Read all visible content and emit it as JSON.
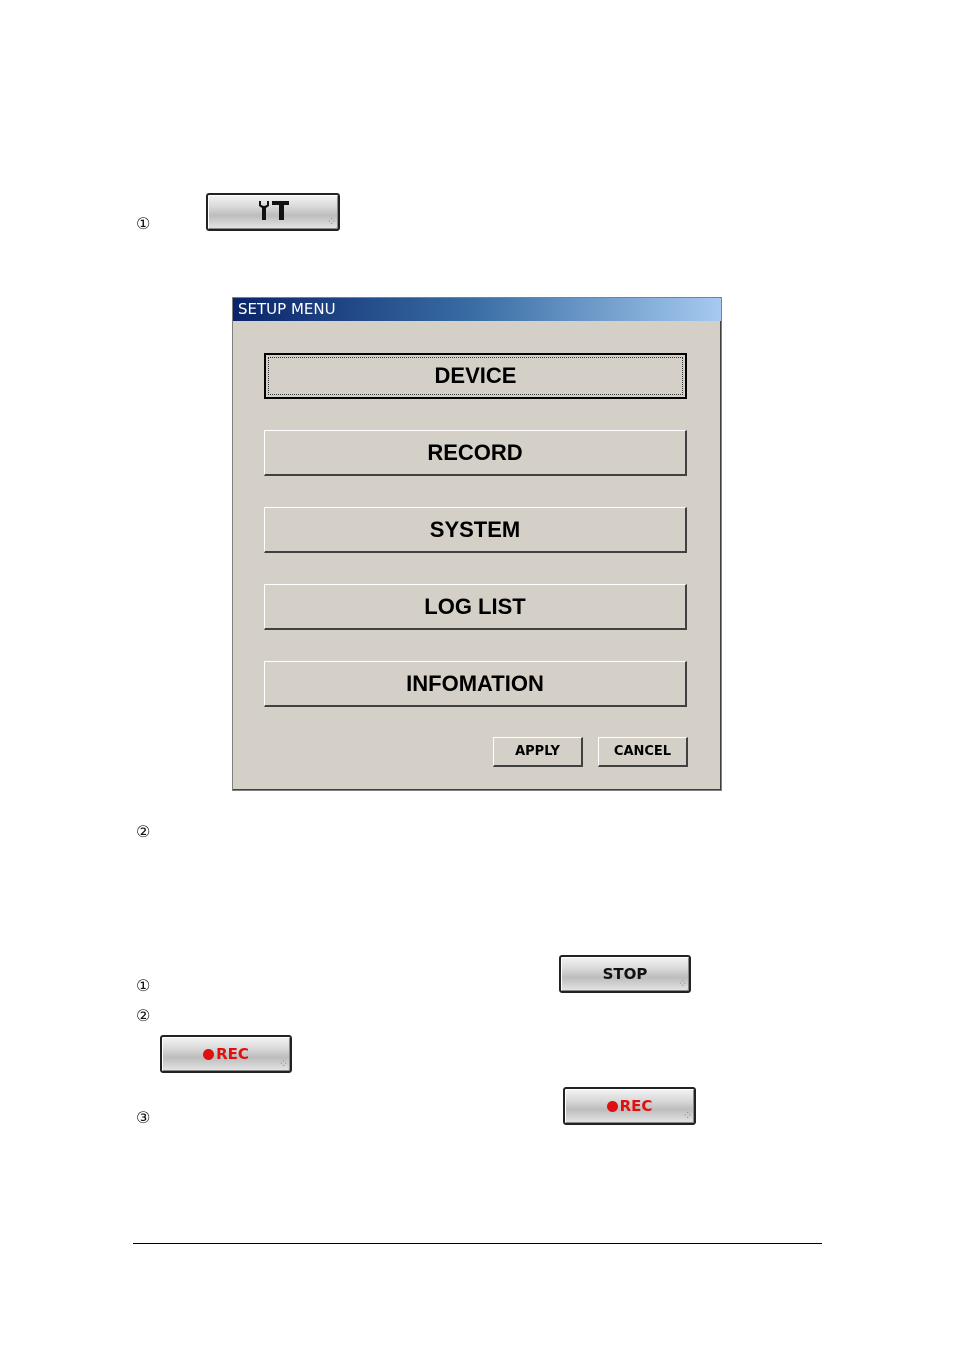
{
  "markers": {
    "step1a": "①",
    "step2a": "②",
    "step1b": "①",
    "step2b": "②",
    "step3b": "③"
  },
  "buttons": {
    "setup_icon": "tools-icon",
    "stop_label": "STOP",
    "rec_label": "REC",
    "rec_label_2": "REC"
  },
  "dialog": {
    "title": "SETUP MENU",
    "menu_items": [
      {
        "label": "DEVICE",
        "focused": true
      },
      {
        "label": "RECORD"
      },
      {
        "label": "SYSTEM"
      },
      {
        "label": "LOG LIST"
      },
      {
        "label": "INFOMATION"
      }
    ],
    "apply_label": "APPLY",
    "cancel_label": "CANCEL"
  },
  "colors": {
    "dialog_bg": "#d4d0c8",
    "title_start": "#0a246a",
    "title_end": "#a6caf0",
    "rec_red": "#e01010"
  }
}
